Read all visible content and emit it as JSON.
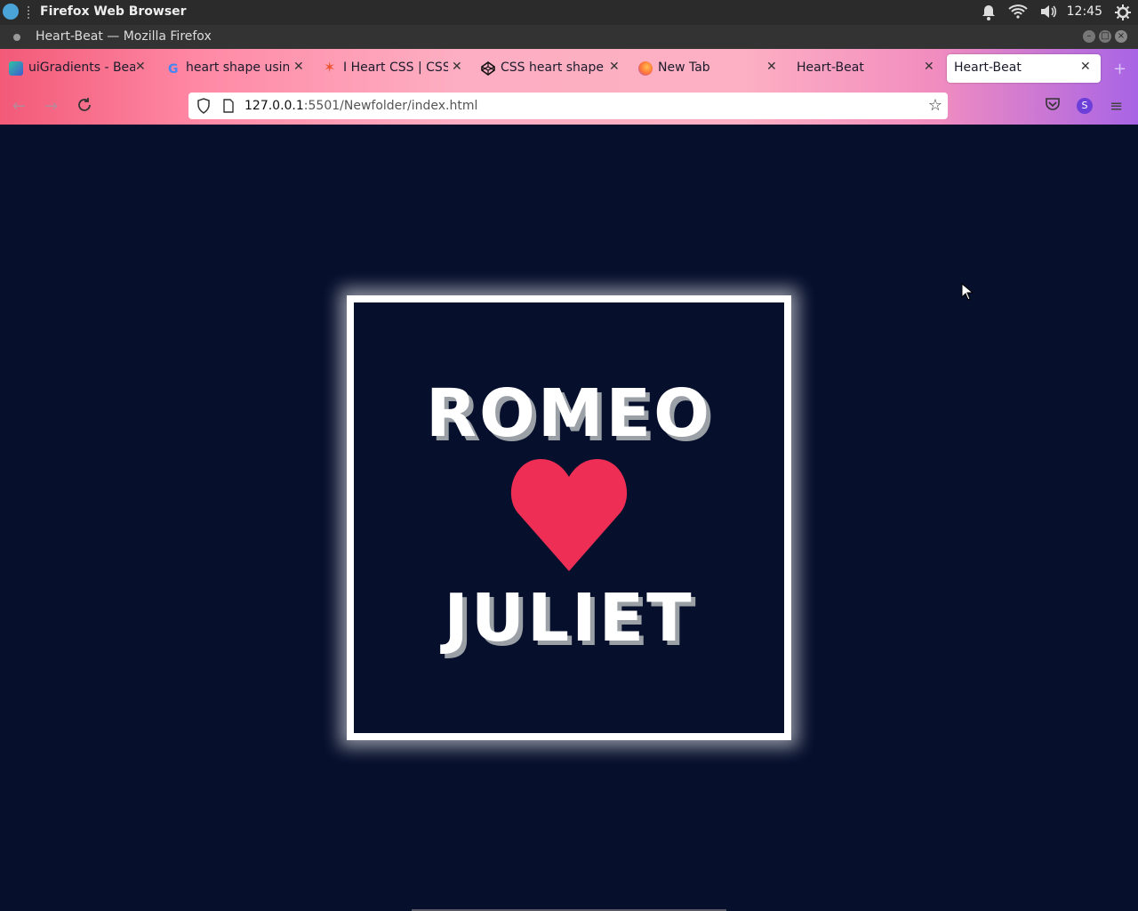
{
  "system_bar": {
    "app_name": "Firefox Web Browser",
    "time": "12:45"
  },
  "window": {
    "title": "Heart-Beat — Mozilla Firefox"
  },
  "tabs": [
    {
      "label": "uiGradients - Beau",
      "icon": "uigradients-icon"
    },
    {
      "label": "heart shape using",
      "icon": "google-icon"
    },
    {
      "label": "I Heart CSS | CSS-T",
      "icon": "iheartcss-icon"
    },
    {
      "label": "CSS heart shape",
      "icon": "codepen-icon"
    },
    {
      "label": "New Tab",
      "icon": "firefox-icon"
    },
    {
      "label": "Heart-Beat",
      "icon": "none"
    },
    {
      "label": "Heart-Beat",
      "icon": "none",
      "active": true
    }
  ],
  "address_bar": {
    "host": "127.0.0.1",
    "rest": ":5501/Newfolder/index.html"
  },
  "account_initial": "S",
  "page": {
    "top_word": "ROMEO",
    "bottom_word": "JULIET",
    "heart_color": "#ee2e55",
    "background": "#060f2c"
  }
}
